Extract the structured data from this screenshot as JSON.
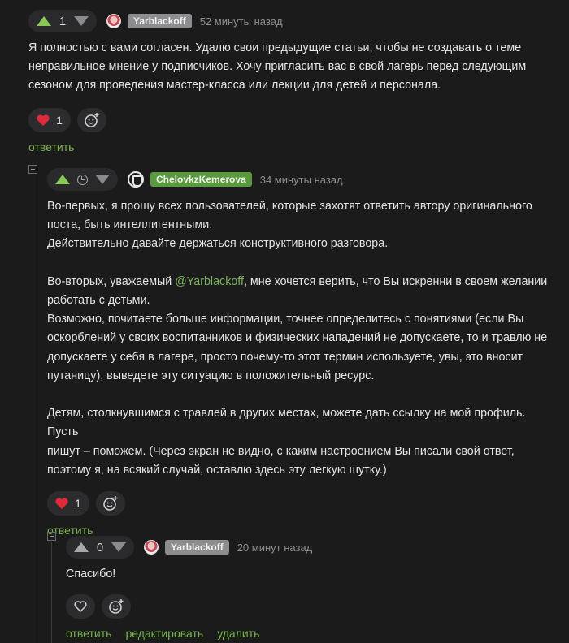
{
  "comments": [
    {
      "votes": "1",
      "author": "Yarblackoff",
      "time": "52 минуты назад",
      "lines": [
        "Я полностью с вами согласен. Удалю свои предыдущие статьи, чтобы не создавать о теме",
        "неправильное мнение у подписчиков. Хочу пригласить вас в свой лагерь перед следующим",
        "сезоном для проведения мастер-класса или лекции для детей и персонала."
      ],
      "likes": "1",
      "reply_label": "ответить"
    },
    {
      "author": "ChelovkzKemerova",
      "time": "34 минуты назад",
      "p1": [
        "Во-первых, я прошу всех пользователей, которые захотят ответить автору оригинального",
        "поста, быть интеллигентными.",
        "Действительно давайте держаться конструктивного разговора."
      ],
      "p2_pre": "Во-вторых, уважаемый ",
      "p2_mention": "@Yarblackoff",
      "p2_post": ", мне хочется верить, что Вы искренни в своем желании",
      "p2_rest": [
        "работать с детьми.",
        "Возможно, почитаете больше информации, точнее определитесь с понятиями (если Вы",
        "оскорблений у своих воспитанников и физических нападений не допускаете, то и травлю не",
        "допускаете у себя в лагере, просто почему-то этот термин используете, увы, это вносит",
        "путаницу), выведете эту ситуацию в положительный ресурс."
      ],
      "p3": [
        "Детям, столкнувшимся с травлей в других местах, можете дать ссылку на мой профиль. Пусть",
        "пишут – поможем. (Через экран не видно, с каким настроением Вы писали свой ответ,",
        "поэтому я, на всякий случай, оставлю здесь эту легкую шутку.)"
      ],
      "likes": "1",
      "reply_label": "ответить"
    },
    {
      "votes": "0",
      "author": "Yarblackoff",
      "time": "20 минут назад",
      "text": "Спасибо!",
      "reply_label": "ответить",
      "edit_label": "редактировать",
      "delete_label": "удалить"
    }
  ],
  "colors": {
    "accent_green": "#78b14f",
    "heart_red": "#e02a3a",
    "background": "#1b1b1c"
  }
}
